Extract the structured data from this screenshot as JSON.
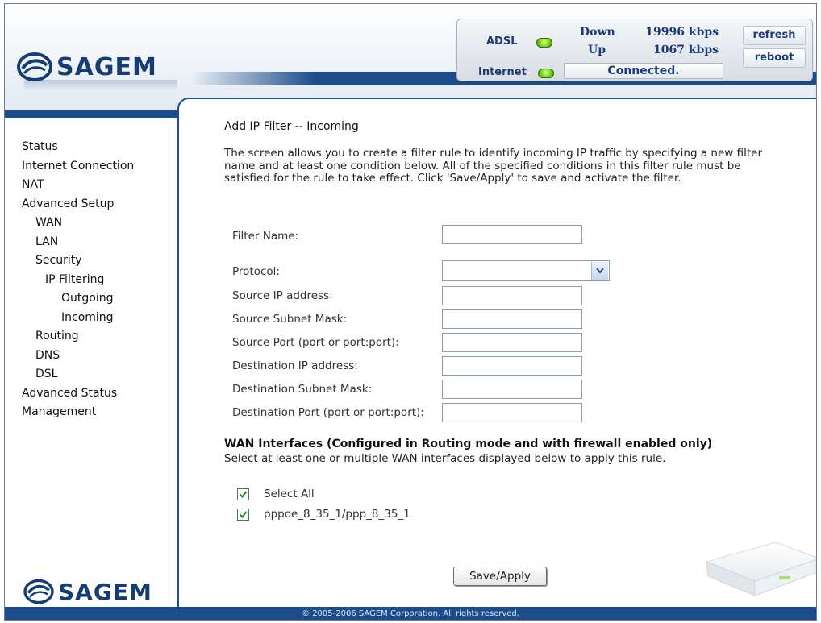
{
  "brand": {
    "name": "SAGEM"
  },
  "status_panel": {
    "adsl_label": "ADSL",
    "internet_label": "Internet",
    "down_label": "Down",
    "down_value": "19996 kbps",
    "up_label": "Up",
    "up_value": "1067 kbps",
    "connection_status": "Connected.",
    "refresh_label": "refresh",
    "reboot_label": "reboot",
    "led_color": "#7bd31c"
  },
  "sidebar": {
    "items": [
      {
        "label": "Status"
      },
      {
        "label": "Internet Connection"
      },
      {
        "label": "NAT"
      },
      {
        "label": "Advanced Setup"
      },
      {
        "label": "WAN"
      },
      {
        "label": "LAN"
      },
      {
        "label": "Security"
      },
      {
        "label": "IP Filtering"
      },
      {
        "label": "Outgoing"
      },
      {
        "label": "Incoming"
      },
      {
        "label": "Routing"
      },
      {
        "label": "DNS"
      },
      {
        "label": "DSL"
      },
      {
        "label": "Advanced Status"
      },
      {
        "label": "Management"
      }
    ]
  },
  "main": {
    "title": "Add IP Filter -- Incoming",
    "description": "The screen allows you to create a filter rule to identify incoming IP traffic by specifying a new filter name and at least one condition below. All of the specified conditions in this filter rule must be satisfied for the rule to take effect. Click 'Save/Apply' to save and activate the filter.",
    "fields": {
      "filter_name": {
        "label": "Filter Name:",
        "value": ""
      },
      "protocol": {
        "label": "Protocol:",
        "value": ""
      },
      "source_ip": {
        "label": "Source IP address:",
        "value": ""
      },
      "source_mask": {
        "label": "Source Subnet Mask:",
        "value": ""
      },
      "source_port": {
        "label": "Source Port (port or port:port):",
        "value": ""
      },
      "dest_ip": {
        "label": "Destination IP address:",
        "value": ""
      },
      "dest_mask": {
        "label": "Destination Subnet Mask:",
        "value": ""
      },
      "dest_port": {
        "label": "Destination Port (port or port:port):",
        "value": ""
      }
    },
    "wan": {
      "title": "WAN Interfaces (Configured in Routing mode and with firewall enabled only)",
      "subtitle": "Select at least one or multiple WAN interfaces displayed below to apply this rule.",
      "select_all_label": "Select All",
      "interface_label": "pppoe_8_35_1/ppp_8_35_1",
      "select_all_checked": true,
      "interface_checked": true
    },
    "save_label": "Save/Apply"
  },
  "footer": {
    "copyright": "© 2005-2006 SAGEM Corporation. All rights reserved."
  },
  "colors": {
    "brand_blue": "#1b4d8c",
    "logo_blue": "#163d73"
  }
}
